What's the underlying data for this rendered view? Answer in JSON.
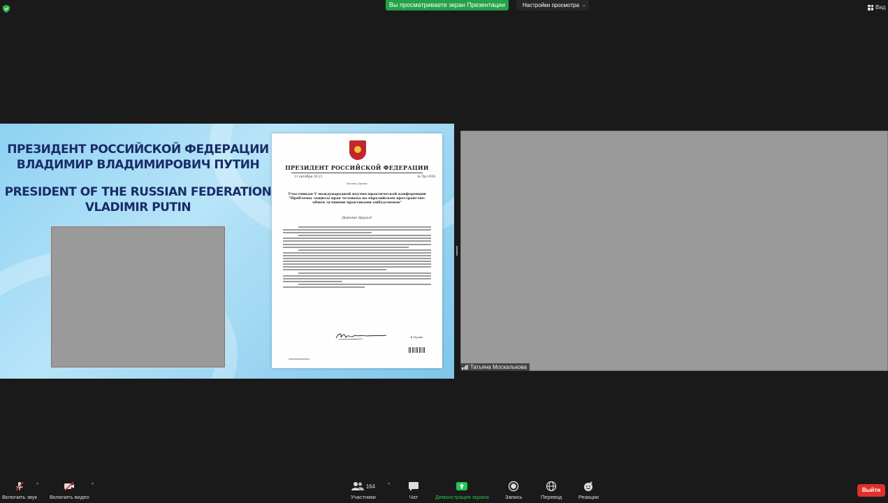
{
  "top_bar": {
    "share_banner": "Вы просматриваете экран Презентации",
    "view_settings": "Настройки просмотра",
    "view_button": "Вид"
  },
  "slide": {
    "title_ru_line1": "ПРЕЗИДЕНТ РОССИЙСКОЙ ФЕДЕРАЦИИ",
    "title_ru_line2": "ВЛАДИМИР ВЛАДИМИРОВИЧ ПУТИН",
    "title_en_line1": "PRESIDENT OF THE RUSSIAN FEDERATION",
    "title_en_line2": "VLADIMIR PUTIN",
    "letter": {
      "header": "ПРЕЗИДЕНТ РОССИЙСКОЙ ФЕДЕРАЦИИ",
      "date": "11 октября 20 21",
      "number": "№ Пр-1928",
      "city": "Москва, Кремль",
      "addressee": "Участникам V международной научно-практической конференции \"Проблемы защиты прав человека на евразийском пространстве: обмен лучшими практиками омбудсменов\"",
      "greeting": "Дорогие друзья!",
      "signature_name": "В.Путин"
    }
  },
  "video": {
    "participant_name": "Татьяна Москалькова"
  },
  "toolbar": {
    "audio": "Включить звук",
    "video": "Включить видео",
    "participants": "Участники",
    "participants_count": "164",
    "chat": "Чат",
    "share": "Демонстрация экрана",
    "record": "Запись",
    "translate": "Перевод",
    "reactions": "Реакции",
    "leave": "Выйти"
  },
  "colors": {
    "share_green": "#23a248",
    "leave_red": "#e0302a",
    "background": "#1a1a1a"
  }
}
